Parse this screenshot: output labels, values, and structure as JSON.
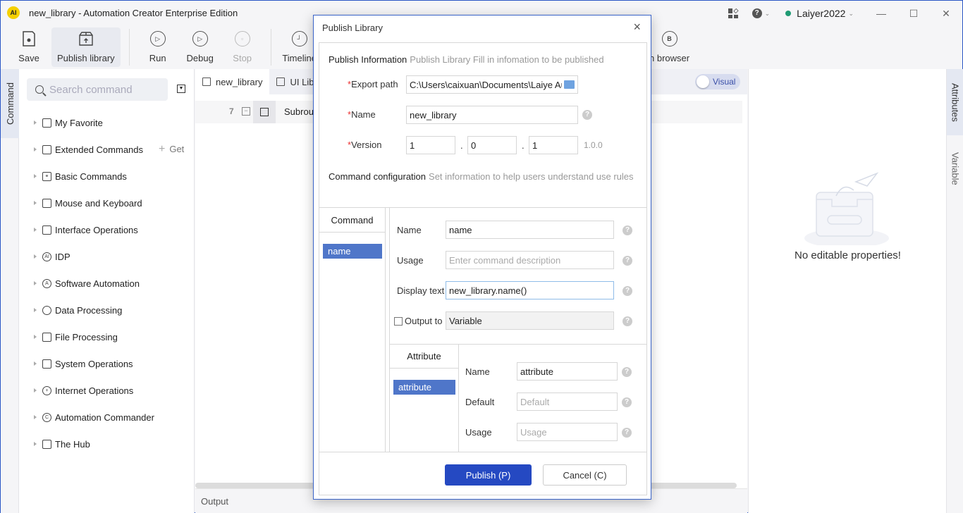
{
  "app": {
    "title": "new_library - Automation Creator Enterprise Edition",
    "logo_text": "AI",
    "user": "Laiyer2022",
    "user_status_color": "#1f9b74",
    "help": "?"
  },
  "toolbar": {
    "items": [
      {
        "label": "Save",
        "icon": "save-icon"
      },
      {
        "label": "Publish library",
        "icon": "publish-box-icon",
        "active": true
      },
      {
        "label": "Run",
        "icon": "run-icon"
      },
      {
        "label": "Debug",
        "icon": "debug-icon"
      },
      {
        "label": "Stop",
        "icon": "stop-icon",
        "disabled": true
      },
      {
        "label": "Timeline",
        "icon": "clock-icon"
      },
      {
        "label": "n browser",
        "icon": "browser-icon",
        "icon_text": "B"
      }
    ]
  },
  "left_tabs": {
    "command": "Command"
  },
  "command_panel": {
    "search_placeholder": "Search command",
    "get_label": "Get",
    "categories": [
      {
        "label": "My Favorite",
        "icon": "folder-icon"
      },
      {
        "label": "Extended Commands",
        "icon": "extended-icon"
      },
      {
        "label": "Basic Commands",
        "icon": "basic-icon"
      },
      {
        "label": "Mouse and Keyboard",
        "icon": "mouse-keyboard-icon"
      },
      {
        "label": "Interface Operations",
        "icon": "interface-icon"
      },
      {
        "label": "IDP",
        "icon": "idp-icon"
      },
      {
        "label": "Software Automation",
        "icon": "software-automation-icon"
      },
      {
        "label": "Data Processing",
        "icon": "pie-chart-icon"
      },
      {
        "label": "File Processing",
        "icon": "file-icon"
      },
      {
        "label": "System Operations",
        "icon": "monitor-icon"
      },
      {
        "label": "Internet Operations",
        "icon": "globe-icon"
      },
      {
        "label": "Automation Commander",
        "icon": "commander-icon"
      },
      {
        "label": "The Hub",
        "icon": "hub-icon"
      }
    ]
  },
  "editor": {
    "tabs": [
      {
        "label": "new_library",
        "active": true
      },
      {
        "label": "UI Lib"
      }
    ],
    "toggle_label": "Visual",
    "rows": [
      {
        "line": "7",
        "text": "Subrou"
      }
    ],
    "output_label": "Output"
  },
  "properties": {
    "empty_text": "No editable properties!",
    "tabs": [
      "Attributes",
      "Variable"
    ]
  },
  "dialog": {
    "title": "Publish Library",
    "publish_info": {
      "title": "Publish Information",
      "subtitle": "Publish Library Fill in infomation to be published",
      "export_path_label": "Export path",
      "export_path_value": "C:\\Users\\caixuan\\Documents\\Laiye Au",
      "name_label": "Name",
      "name_value": "new_library",
      "version_label": "Version",
      "version": [
        "1",
        "0",
        "1"
      ],
      "version_hint": "1.0.0",
      "required_mark": "*"
    },
    "command_config": {
      "title": "Command configuration",
      "subtitle": "Set information to help users understand use rules",
      "list_header": "Command",
      "commands": [
        "name"
      ],
      "fields": {
        "name_label": "Name",
        "name_value": "name",
        "usage_label": "Usage",
        "usage_placeholder": "Enter command description",
        "display_label": "Display text",
        "display_value": "new_library.name()",
        "output_label": "Output to",
        "output_value": "Variable",
        "output_checked": false
      },
      "attribute": {
        "list_header": "Attribute",
        "items": [
          "attribute"
        ],
        "name_label": "Name",
        "name_value": "attribute",
        "default_label": "Default",
        "default_placeholder": "Default",
        "usage_label": "Usage",
        "usage_placeholder": "Usage"
      }
    },
    "buttons": {
      "publish": "Publish (P)",
      "cancel": "Cancel (C)"
    }
  }
}
